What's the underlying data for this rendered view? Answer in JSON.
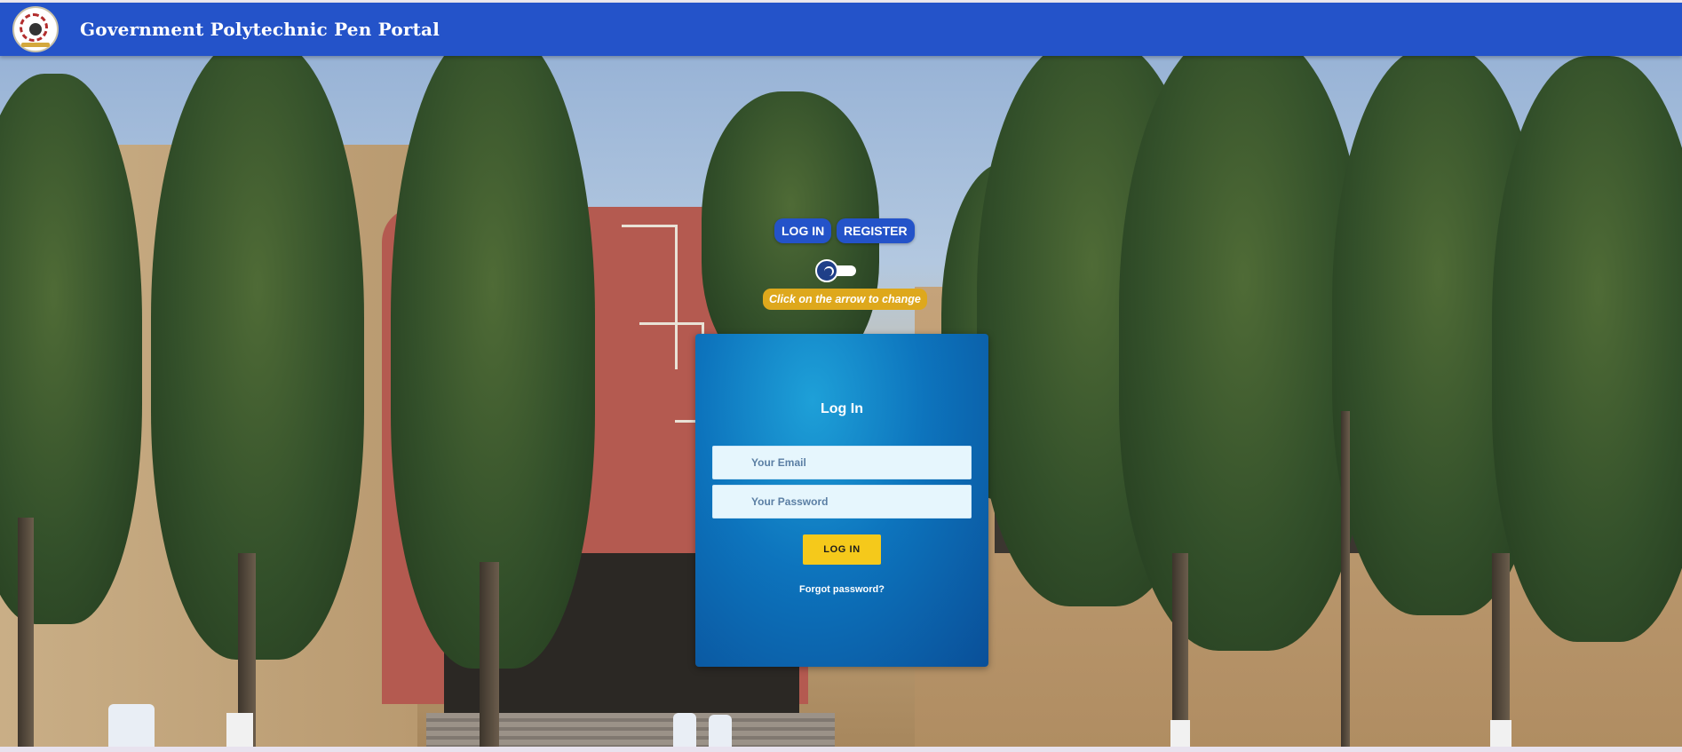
{
  "header": {
    "title": "Government Polytechnic Pen Portal",
    "bg_color": "#2453c9",
    "logo_icon": "college-emblem-logo"
  },
  "mode_switch": {
    "login_label": "LOG IN",
    "register_label": "REGISTER",
    "hint": "Click on the arrow to change",
    "hint_color": "#dea81c",
    "arrow_icon": "toggle-arrow-icon"
  },
  "login_card": {
    "title": "Log In",
    "email_placeholder": "Your Email",
    "password_placeholder": "Your Password",
    "submit_label": "LOG IN",
    "submit_color": "#f5c91b",
    "forgot_label": "Forgot password?"
  }
}
